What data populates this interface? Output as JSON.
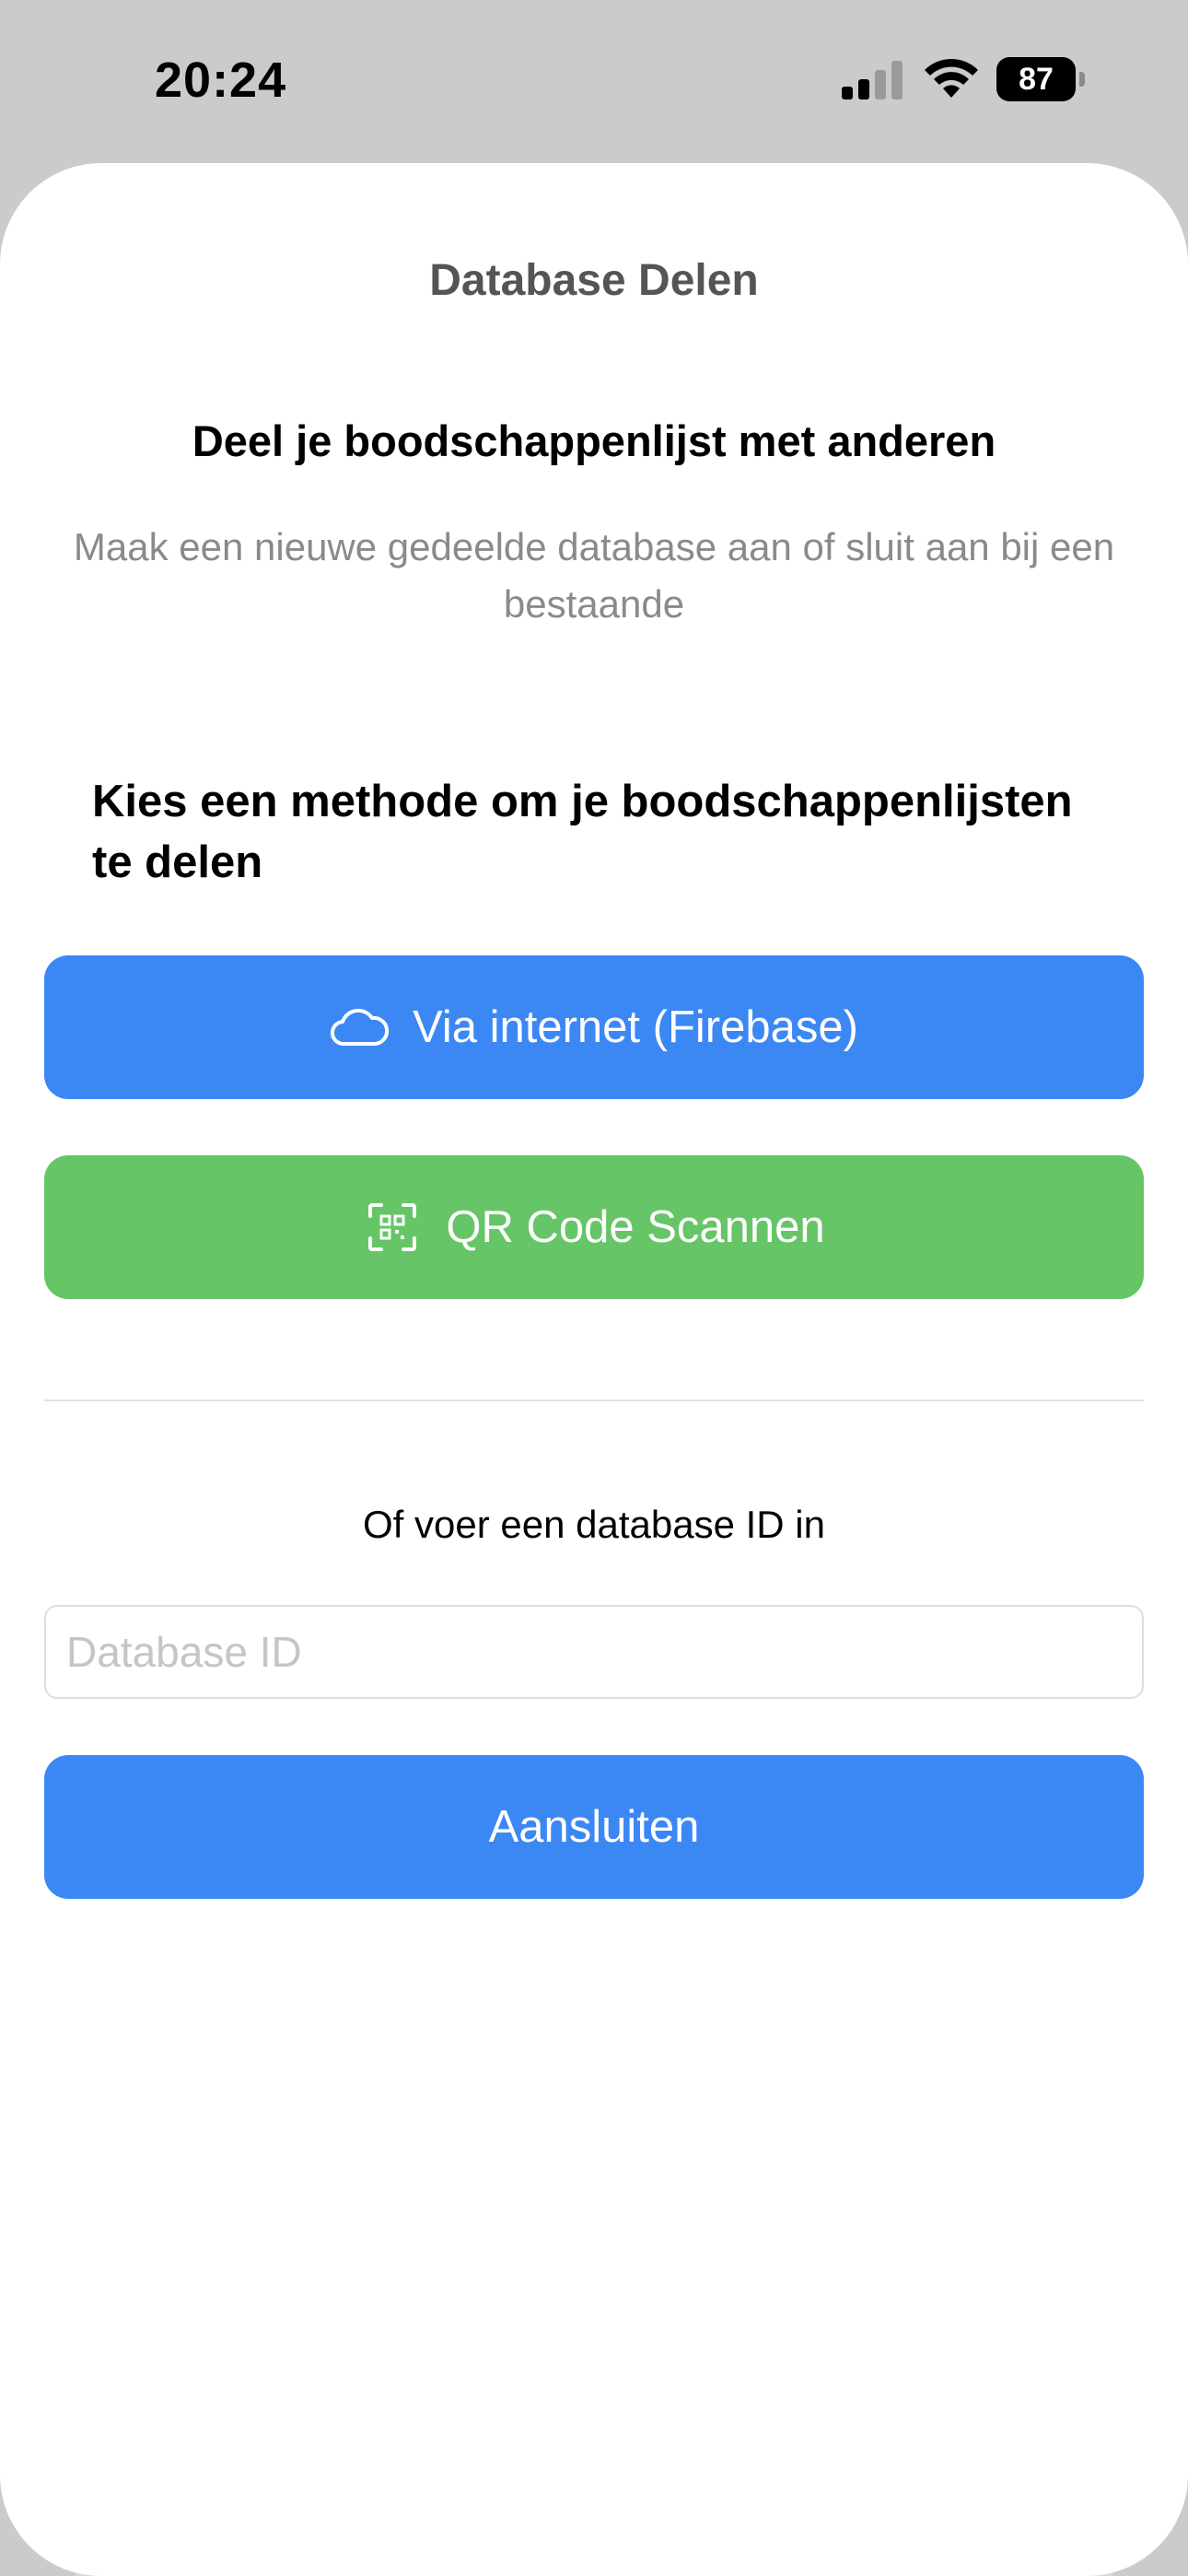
{
  "status_bar": {
    "time": "20:24",
    "battery": "87",
    "icons": [
      "signal-icon",
      "wifi-icon",
      "battery-icon"
    ]
  },
  "sheet": {
    "title": "Database Delen",
    "heading": "Deel je boodschappenlijst met anderen",
    "subtitle": "Maak een nieuwe gedeelde database aan of sluit aan bij een bestaande",
    "method_heading": "Kies een methode om je boodschappenlijsten te delen",
    "firebase_button": {
      "label": "Via internet (Firebase)",
      "icon": "cloud-icon"
    },
    "qr_button": {
      "label": "QR Code Scannen",
      "icon": "qr-scan-icon"
    },
    "or_label": "Of voer een database ID in",
    "database_input": {
      "value": "",
      "placeholder": "Database ID"
    },
    "join_button": {
      "label": "Aansluiten"
    }
  },
  "colors": {
    "primary_blue": "#3b88f5",
    "green": "#66c566",
    "muted_text": "#8a8a8a",
    "title_gray": "#555555"
  }
}
